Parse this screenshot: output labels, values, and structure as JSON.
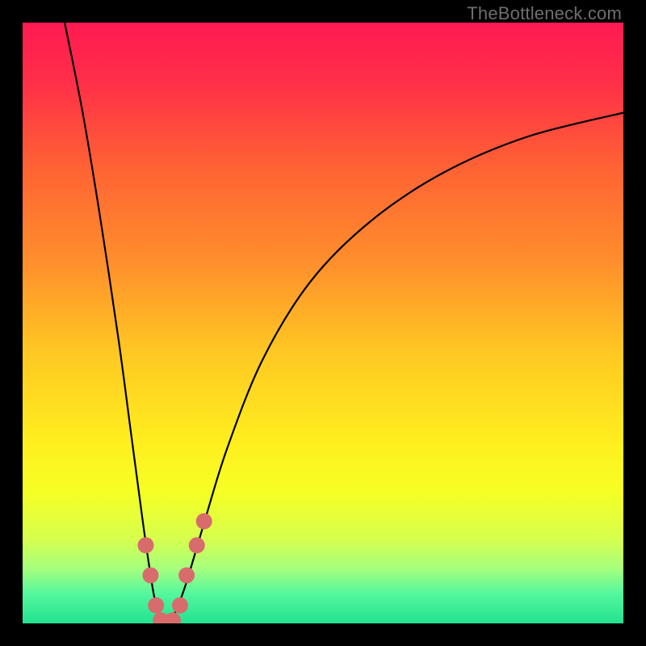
{
  "watermark": "TheBottleneck.com",
  "gradient": {
    "stops": [
      {
        "offset": 0.0,
        "color": "#ff1a52"
      },
      {
        "offset": 0.1,
        "color": "#ff2f48"
      },
      {
        "offset": 0.25,
        "color": "#ff6533"
      },
      {
        "offset": 0.4,
        "color": "#ff8f2c"
      },
      {
        "offset": 0.55,
        "color": "#ffc823"
      },
      {
        "offset": 0.7,
        "color": "#ffef1f"
      },
      {
        "offset": 0.78,
        "color": "#f6ff24"
      },
      {
        "offset": 0.86,
        "color": "#d6ff4e"
      },
      {
        "offset": 0.91,
        "color": "#a4ff7e"
      },
      {
        "offset": 0.95,
        "color": "#55f79e"
      },
      {
        "offset": 1.0,
        "color": "#23e28f"
      }
    ]
  },
  "chart_data": {
    "type": "line",
    "title": "",
    "xlabel": "",
    "ylabel": "",
    "xlim": [
      0,
      100
    ],
    "ylim": [
      0,
      100
    ],
    "series": [
      {
        "name": "bottleneck-curve",
        "x": [
          7,
          10,
          13,
          16,
          18,
          20,
          21,
          22,
          23,
          24,
          25,
          27,
          30,
          34,
          40,
          48,
          58,
          70,
          84,
          100
        ],
        "y": [
          100,
          85,
          67,
          47,
          32,
          17,
          10,
          4,
          1,
          0,
          1,
          6,
          16,
          29,
          44,
          57,
          67,
          75,
          81,
          85
        ]
      }
    ],
    "markers": {
      "name": "sample-points",
      "color": "#d86b6b",
      "radius_px": 10,
      "points": [
        {
          "x": 20.5,
          "y": 13
        },
        {
          "x": 21.3,
          "y": 8
        },
        {
          "x": 22.2,
          "y": 3
        },
        {
          "x": 23.0,
          "y": 0.5
        },
        {
          "x": 24.0,
          "y": 0.2
        },
        {
          "x": 25.0,
          "y": 0.5
        },
        {
          "x": 26.2,
          "y": 3
        },
        {
          "x": 27.3,
          "y": 8
        },
        {
          "x": 29.0,
          "y": 13
        },
        {
          "x": 30.2,
          "y": 17
        }
      ]
    }
  }
}
